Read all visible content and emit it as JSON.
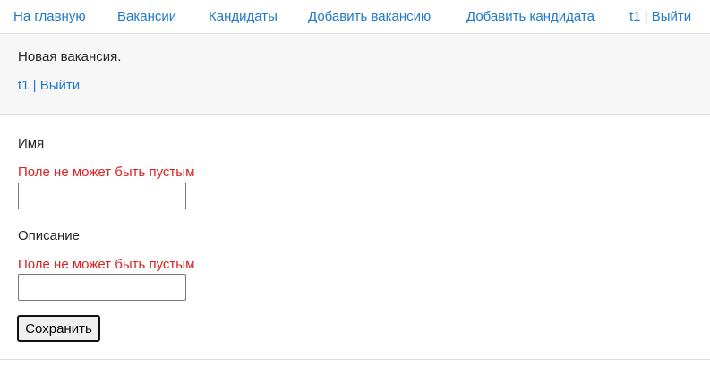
{
  "nav": {
    "home": "На главную",
    "vacancies": "Вакансии",
    "candidates": "Кандидаты",
    "add_vacancy": "Добавить вакансию",
    "add_candidate": "Добавить кандидата",
    "user_logout": "t1 | Выйти"
  },
  "card_header": {
    "title": "Новая вакансия.",
    "user_logout": "t1 | Выйти"
  },
  "form": {
    "name": {
      "label": "Имя",
      "error": "Поле не может быть пустым",
      "value": ""
    },
    "description": {
      "label": "Описание",
      "error": "Поле не может быть пустым",
      "value": ""
    },
    "save_label": "Сохранить"
  },
  "colors": {
    "link": "#1f78c8",
    "error": "#dc2121",
    "header_bg": "#f7f7f7"
  }
}
